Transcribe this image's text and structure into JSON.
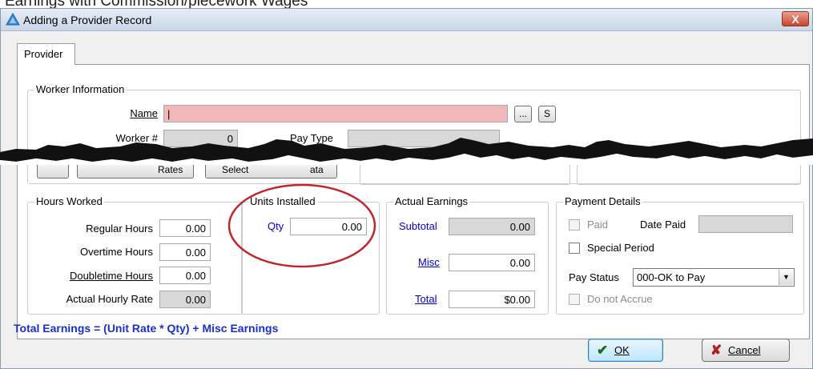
{
  "top_caption": "Earnings with Commission/piecework Wages",
  "window": {
    "title": "Adding a Provider Record",
    "close_icon": "close-icon",
    "close_label": "X"
  },
  "tabs": [
    {
      "label": "Provider",
      "active": true
    }
  ],
  "worker_info": {
    "legend": "Worker Information",
    "name_label": "Name",
    "name_value": "|",
    "browse_label": "...",
    "s_label": "S",
    "worker_num_label": "Worker #",
    "worker_num_value": "0",
    "pay_type_label": "Pay Type",
    "pay_type_value": ""
  },
  "obscured_row": {
    "rates_label": "Rates",
    "select_label": "Select",
    "ata_label": "ata"
  },
  "hours_worked": {
    "legend": "Hours Worked",
    "rows": [
      {
        "label": "Regular Hours",
        "value": "0.00"
      },
      {
        "label": "Overtime Hours",
        "value": "0.00"
      },
      {
        "label": "Doubletime Hours",
        "value": "0.00"
      },
      {
        "label": "Actual Hourly Rate",
        "value": "0.00"
      }
    ]
  },
  "units_installed": {
    "legend": "Units Installed",
    "qty_label": "Qty",
    "qty_value": "0.00"
  },
  "actual_earnings": {
    "legend": "Actual Earnings",
    "subtotal_label": "Subtotal",
    "subtotal_value": "0.00",
    "misc_label": "Misc",
    "misc_value": "0.00",
    "total_label": "Total",
    "total_value": "$0.00"
  },
  "payment_details": {
    "legend": "Payment Details",
    "paid_label": "Paid",
    "date_paid_label": "Date Paid",
    "date_paid_value": "",
    "special_period_label": "Special Period",
    "pay_status_label": "Pay Status",
    "pay_status_value": "000-OK to Pay",
    "do_not_accrue_label": "Do not Accrue"
  },
  "formula_text": "Total Earnings = (Unit Rate * Qty) + Misc Earnings",
  "buttons": {
    "ok_label": "OK",
    "cancel_label": "Cancel"
  },
  "colors": {
    "highlight_circle": "#c0262c",
    "formula": "#1a2fc9",
    "link_blue": "#0000cc",
    "name_field": "#f2b8b8"
  }
}
